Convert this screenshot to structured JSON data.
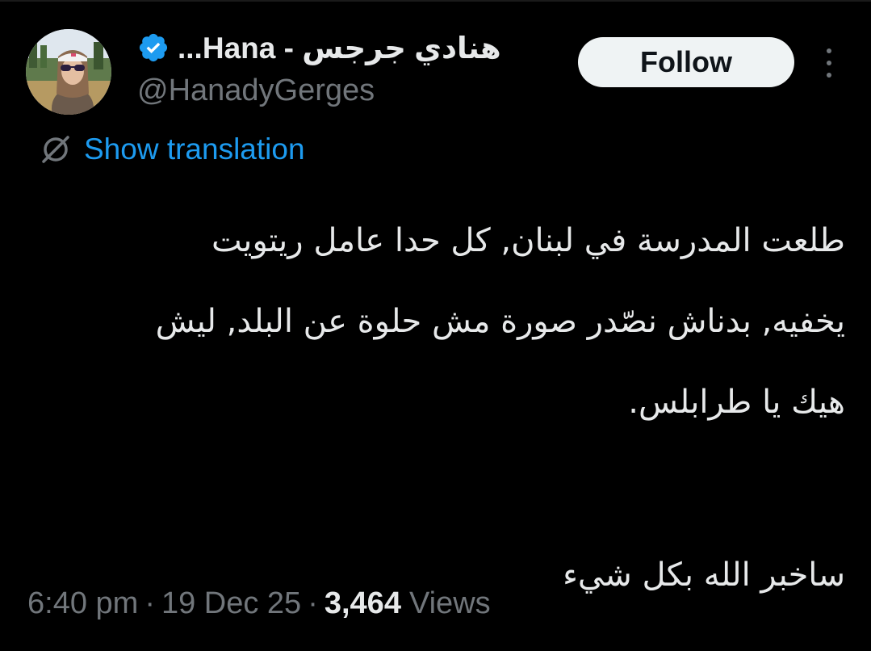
{
  "author": {
    "display_name": "هنادي جرجس - Hana...",
    "handle": "@HanadyGerges",
    "verified_icon": "verified-badge-icon",
    "avatar_icon": "profile-photo"
  },
  "actions": {
    "follow_label": "Follow",
    "more_icon": "more-options-icon"
  },
  "translation": {
    "icon": "globe-translate-icon",
    "label": "Show translation"
  },
  "tweet": {
    "lines": [
      "طلعت المدرسة في لبنان, كل حدا عامل ريتويت",
      "يخفيه, بدناش نصّدر صورة مش حلوة عن البلد, ليش",
      "هيك يا طرابلس."
    ],
    "closing": "ساخبر الله بكل شيء"
  },
  "meta": {
    "time": "6:40 pm",
    "separator": "·",
    "date": "19 Dec 25",
    "views_count": "3,464",
    "views_label": "Views"
  },
  "colors": {
    "background": "#000000",
    "text": "#e7e9ea",
    "muted": "#71767b",
    "link": "#1d9bf0",
    "verified": "#1d9bf0",
    "follow_bg": "#eff3f4"
  }
}
